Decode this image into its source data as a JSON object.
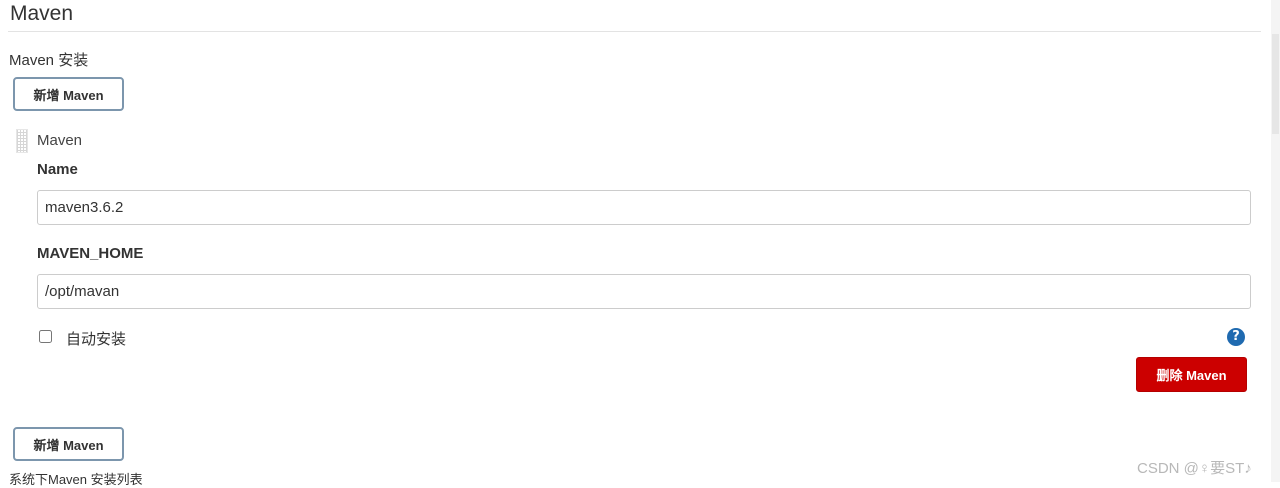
{
  "section": {
    "title": "Maven"
  },
  "install": {
    "label": "Maven 安装",
    "add_button_label": "新增 Maven"
  },
  "maven_block": {
    "title": "Maven",
    "name_label": "Name",
    "name_value": "maven3.6.2",
    "home_label": "MAVEN_HOME",
    "home_value": "/opt/mavan",
    "auto_install_label": "自动安装",
    "auto_install_checked": false,
    "help_icon": "question-mark-icon",
    "delete_button_label": "删除 Maven"
  },
  "footer": {
    "add_button_label": "新增 Maven",
    "note": "系统下Maven 安装列表"
  },
  "watermark": "CSDN @♀要ST♪",
  "colors": {
    "delete_button": "#cc0000",
    "help_icon": "#1f6ab0",
    "add_button_border": "#7c96ad"
  }
}
